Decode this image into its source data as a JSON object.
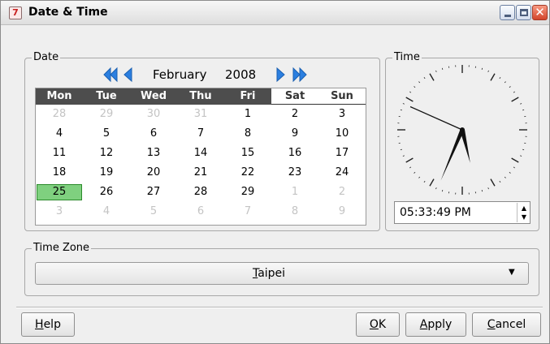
{
  "window": {
    "title": "Date & Time"
  },
  "date_group": {
    "title": "Date",
    "month": "February",
    "year": "2008",
    "weekday_headers": [
      "Mon",
      "Tue",
      "Wed",
      "Thu",
      "Fri",
      "Sat",
      "Sun"
    ],
    "weeks": [
      [
        "28",
        "29",
        "30",
        "31",
        "1",
        "2",
        "3"
      ],
      [
        "4",
        "5",
        "6",
        "7",
        "8",
        "9",
        "10"
      ],
      [
        "11",
        "12",
        "13",
        "14",
        "15",
        "16",
        "17"
      ],
      [
        "18",
        "19",
        "20",
        "21",
        "22",
        "23",
        "24"
      ],
      [
        "25",
        "26",
        "27",
        "28",
        "29",
        "1",
        "2"
      ],
      [
        "3",
        "4",
        "5",
        "6",
        "7",
        "8",
        "9"
      ]
    ],
    "selected_day": "25"
  },
  "time_group": {
    "title": "Time",
    "time_value": "05:33:49 PM",
    "clock": {
      "hours": 5,
      "minutes": 33,
      "seconds": 49
    }
  },
  "timezone_group": {
    "title": "Time Zone",
    "selected": {
      "mnemonic": "T",
      "rest": "aipei"
    }
  },
  "buttons": {
    "help": {
      "mnemonic": "H",
      "rest": "elp"
    },
    "ok": {
      "mnemonic": "O",
      "rest": "K"
    },
    "apply": {
      "mnemonic": "A",
      "rest": "pply"
    },
    "cancel": {
      "mnemonic": "C",
      "rest": "ancel"
    }
  },
  "colors": {
    "accent_arrows": "#2b7fe0",
    "selected_day_bg": "#7fd07f",
    "header_dark": "#4d4d4d"
  },
  "icons": {
    "prev_year": "double-left-arrow-icon",
    "prev_month": "left-arrow-icon",
    "next_month": "right-arrow-icon",
    "next_year": "double-right-arrow-icon"
  }
}
